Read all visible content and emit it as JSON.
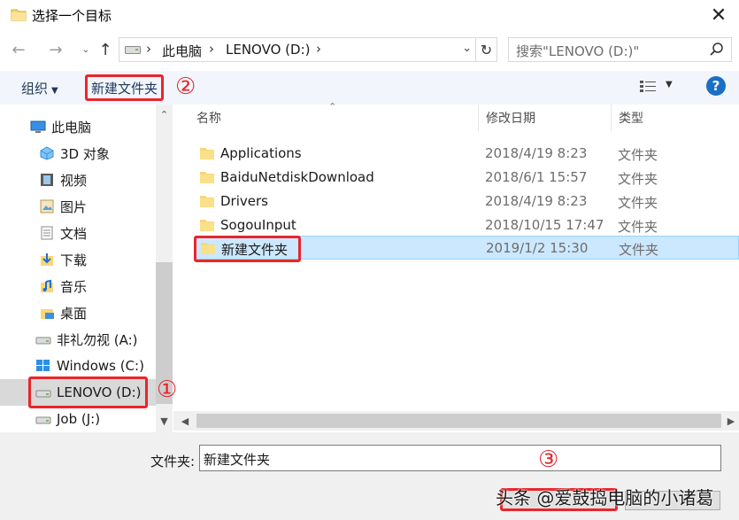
{
  "window": {
    "title": "选择一个目标",
    "close_glyph": "✕"
  },
  "nav": {
    "back_glyph": "←",
    "forward_glyph": "→",
    "recent_glyph": "⌄",
    "up_glyph": "↑",
    "breadcrumb": [
      "此电脑",
      "LENOVO (D:)"
    ],
    "separator_glyph": "›",
    "dropdown_glyph": "⌄",
    "refresh_glyph": "↻",
    "search_placeholder": "搜索\"LENOVO (D:)\""
  },
  "toolbar": {
    "organize_label": "组织",
    "organize_arrow": "▼",
    "new_folder_label": "新建文件夹",
    "view_arrow": "▼",
    "help_label": "?"
  },
  "annotations": {
    "marker1": "①",
    "marker2": "②",
    "marker3": "③"
  },
  "sidebar": {
    "items": [
      {
        "label": "此电脑",
        "icon": "computer-icon"
      },
      {
        "label": "3D 对象",
        "icon": "objects-3d-icon"
      },
      {
        "label": "视频",
        "icon": "video-icon"
      },
      {
        "label": "图片",
        "icon": "pictures-icon"
      },
      {
        "label": "文档",
        "icon": "documents-icon"
      },
      {
        "label": "下载",
        "icon": "download-icon"
      },
      {
        "label": "音乐",
        "icon": "music-icon"
      },
      {
        "label": "桌面",
        "icon": "desktop-icon"
      },
      {
        "label": "非礼勿视 (A:)",
        "icon": "drive-icon"
      },
      {
        "label": "Windows (C:)",
        "icon": "windows-drive-icon"
      },
      {
        "label": "LENOVO (D:)",
        "icon": "drive-icon",
        "selected": true
      },
      {
        "label": "Job (J:)",
        "icon": "drive-icon"
      }
    ],
    "scroll_up_glyph": "▲",
    "scroll_down_glyph": "▼",
    "collapse_glyph": "⌃"
  },
  "filelist": {
    "columns": {
      "name": "名称",
      "date": "修改日期",
      "type": "类型"
    },
    "sort_glyph": "⌃",
    "rows": [
      {
        "name": "Applications",
        "date": "2018/4/19 8:23",
        "type": "文件夹"
      },
      {
        "name": "BaiduNetdiskDownload",
        "date": "2018/6/1 15:57",
        "type": "文件夹"
      },
      {
        "name": "Drivers",
        "date": "2018/4/19 8:23",
        "type": "文件夹"
      },
      {
        "name": "SogouInput",
        "date": "2018/10/15 17:47",
        "type": "文件夹"
      },
      {
        "name": "新建文件夹",
        "date": "2019/1/2 15:30",
        "type": "文件夹",
        "selected": true
      }
    ],
    "hscroll_left_glyph": "◀",
    "hscroll_right_glyph": "▶"
  },
  "bottom": {
    "folder_label": "文件夹:",
    "folder_value": "新建文件夹",
    "watermark": "头条 @爱鼓捣电脑的小诸葛"
  },
  "colors": {
    "highlight": "#e8262b",
    "selection": "#cce8ff",
    "folder": "#f8d775",
    "help": "#1a6ec6"
  }
}
